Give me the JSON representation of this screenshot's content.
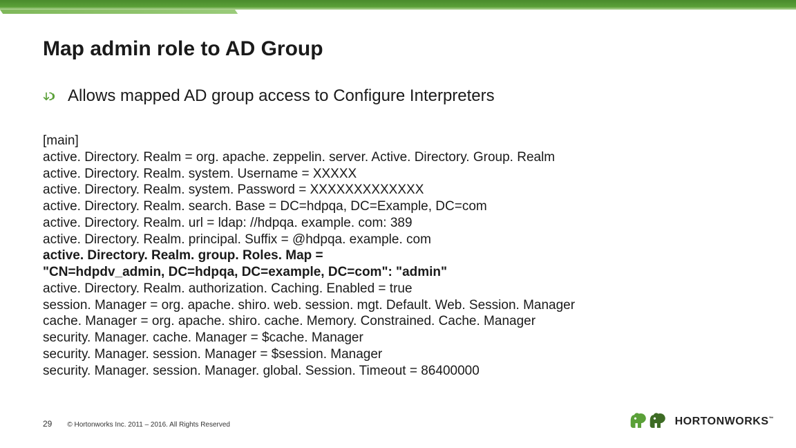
{
  "title": "Map admin role to AD Group",
  "bullet": "Allows mapped AD group access to Configure Interpreters",
  "config_lines": [
    {
      "text": "[main]",
      "bold": false
    },
    {
      "text": "active. Directory. Realm = org. apache. zeppelin. server. Active. Directory. Group. Realm",
      "bold": false
    },
    {
      "text": "active. Directory. Realm. system. Username = XXXXX",
      "bold": false
    },
    {
      "text": "active. Directory. Realm. system. Password = XXXXXXXXXXXXX",
      "bold": false
    },
    {
      "text": "active. Directory. Realm. search. Base = DC=hdpqa, DC=Example, DC=com",
      "bold": false
    },
    {
      "text": "active. Directory. Realm. url = ldap: //hdpqa. example. com: 389",
      "bold": false
    },
    {
      "text": "active. Directory. Realm. principal. Suffix = @hdpqa. example. com",
      "bold": false
    },
    {
      "text": "active. Directory. Realm. group. Roles. Map =",
      "bold": true
    },
    {
      "text": "\"CN=hdpdv_admin, DC=hdpqa, DC=example, DC=com\": \"admin\"",
      "bold": true
    },
    {
      "text": "active. Directory. Realm. authorization. Caching. Enabled = true",
      "bold": false
    },
    {
      "text": "session. Manager = org. apache. shiro. web. session. mgt. Default. Web. Session. Manager",
      "bold": false
    },
    {
      "text": "cache. Manager = org. apache. shiro. cache. Memory. Constrained. Cache. Manager",
      "bold": false
    },
    {
      "text": "security. Manager. cache. Manager = $cache. Manager",
      "bold": false
    },
    {
      "text": "security. Manager. session. Manager = $session. Manager",
      "bold": false
    },
    {
      "text": "security. Manager. session. Manager. global. Session. Timeout = 86400000",
      "bold": false
    }
  ],
  "page_number": "29",
  "copyright": "© Hortonworks Inc. 2011 – 2016. All Rights Reserved",
  "logo_text": "HORTONWORKS",
  "logo_tm": "™"
}
